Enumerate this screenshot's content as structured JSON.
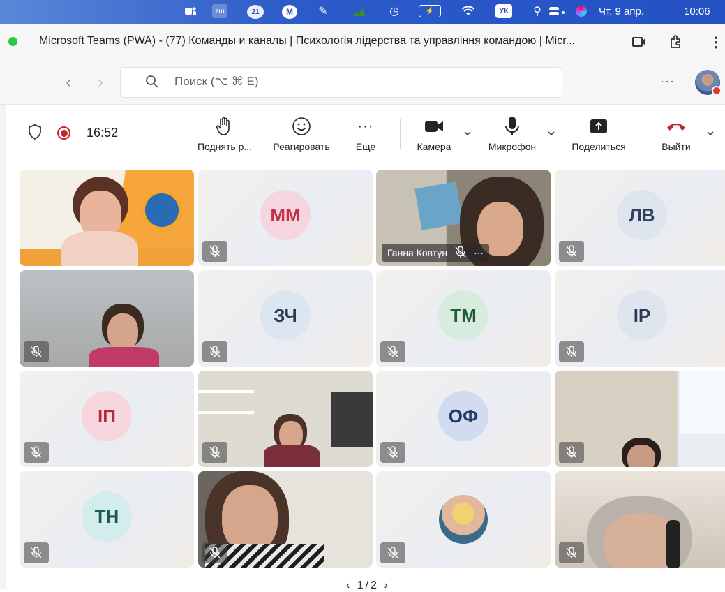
{
  "menubar": {
    "items": [
      "zm",
      "21",
      "M",
      "УК"
    ],
    "date": "Чт, 9 апр.",
    "time": "10:06"
  },
  "window": {
    "title": "Microsoft Teams (PWA) - (77) Команды и каналы | Психологія лідерства та управління командою | Micr..."
  },
  "search": {
    "placeholder": "Поиск (⌥ ⌘ E)"
  },
  "nav": {
    "more": "···"
  },
  "call": {
    "timer": "16:52",
    "controls": [
      {
        "label": "Поднять р...",
        "icon": "raise-hand-icon"
      },
      {
        "label": "Реагировать",
        "icon": "react-icon"
      },
      {
        "label": "Еще",
        "icon": "more-icon"
      },
      {
        "label": "Камера",
        "icon": "camera-icon"
      },
      {
        "label": "Микрофон",
        "icon": "microphone-icon"
      },
      {
        "label": "Поделиться",
        "icon": "share-icon"
      },
      {
        "label": "Выйти",
        "icon": "leave-icon"
      }
    ]
  },
  "participants": [
    {
      "type": "video",
      "scene": "presenter"
    },
    {
      "type": "initials",
      "initials": "ММ",
      "bg": "#f5d6de",
      "fg": "#c4314b"
    },
    {
      "type": "video",
      "scene": "woman-down",
      "name": "Ганна Ковтун"
    },
    {
      "type": "initials",
      "initials": "ЛВ",
      "bg": "#dfe5ee",
      "fg": "#32425e"
    },
    {
      "type": "video",
      "scene": "woman-office"
    },
    {
      "type": "initials",
      "initials": "ЗЧ",
      "bg": "#dce6f0",
      "fg": "#2b3a55"
    },
    {
      "type": "initials",
      "initials": "ТМ",
      "bg": "#d7ebdf",
      "fg": "#1f5e3a"
    },
    {
      "type": "initials",
      "initials": "ІР",
      "bg": "#dfe5ee",
      "fg": "#2b3a55"
    },
    {
      "type": "initials",
      "initials": "ІП",
      "bg": "#f7d7dd",
      "fg": "#b3283f"
    },
    {
      "type": "video",
      "scene": "shelves"
    },
    {
      "type": "initials",
      "initials": "ОФ",
      "bg": "#d2dcf0",
      "fg": "#213a6e"
    },
    {
      "type": "video",
      "scene": "window-room"
    },
    {
      "type": "initials",
      "initials": "ТН",
      "bg": "#d3ecec",
      "fg": "#1f5757"
    },
    {
      "type": "video",
      "scene": "woman-close"
    },
    {
      "type": "avatar",
      "scene": "photo-avatar"
    },
    {
      "type": "video",
      "scene": "older-woman"
    }
  ],
  "pager": {
    "label": "1/2"
  },
  "colors": {
    "record": "#c4262e",
    "leave": "#c4262e",
    "accent": "#5b5fc7"
  }
}
